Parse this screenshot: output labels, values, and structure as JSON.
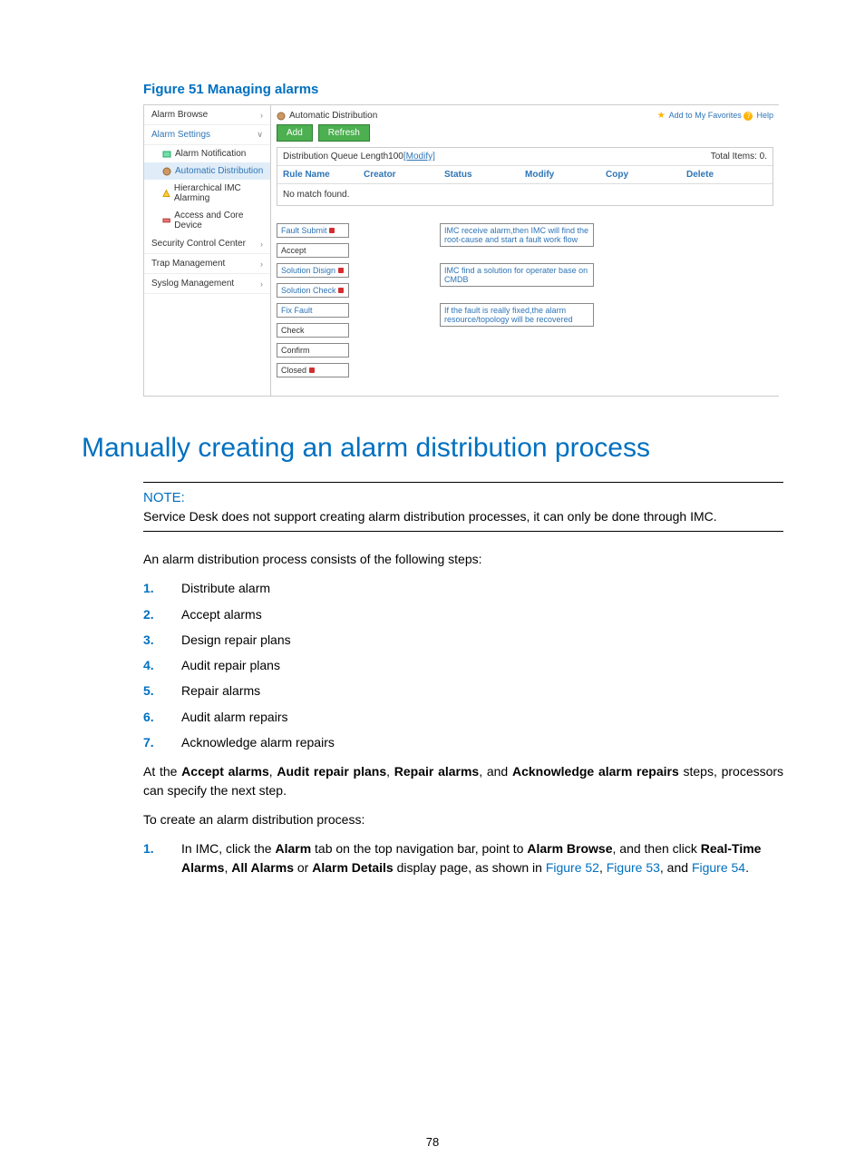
{
  "figure_caption": "Figure 51 Managing alarms",
  "screenshot": {
    "sidebar": {
      "alarm_browse": "Alarm Browse",
      "alarm_settings": "Alarm Settings",
      "alarm_notification": "Alarm Notification",
      "automatic_distribution": "Automatic Distribution",
      "hierarchical_imc": "Hierarchical IMC Alarming",
      "access_core": "Access and Core Device",
      "security_control": "Security Control Center",
      "trap_mgmt": "Trap Management",
      "syslog_mgmt": "Syslog Management"
    },
    "crumb_title": "Automatic Distribution",
    "add_favorites": "Add to My Favorites",
    "help_label": "Help",
    "add_btn": "Add",
    "refresh_btn": "Refresh",
    "queue_label": "Distribution Queue Length100",
    "queue_modify": "[Modify]",
    "total_items": "Total Items: 0.",
    "cols": {
      "rule_name": "Rule Name",
      "creator": "Creator",
      "status": "Status",
      "modify": "Modify",
      "copy": "Copy",
      "delete": "Delete"
    },
    "no_match": "No match found.",
    "flow": {
      "fault_submit": "Fault Submit",
      "accept": "Accept",
      "solution_design": "Solution Disign",
      "solution_check": "Solution Check",
      "fix_fault": "Fix Fault",
      "check": "Check",
      "confirm": "Confirm",
      "closed": "Closed",
      "ann1": "IMC receive alarm,then IMC will find the root-cause and start a fault work flow",
      "ann2": "IMC find a solution for operater base on CMDB",
      "ann3": "If the fault is really fixed,the alarm resource/topology will be recovered"
    }
  },
  "h1": "Manually creating an alarm distribution process",
  "note_label": "NOTE:",
  "note_text": "Service Desk does not support creating alarm distribution processes, it can only be done through IMC.",
  "intro": "An alarm distribution process consists of the following steps:",
  "list": [
    "Distribute alarm",
    "Accept alarms",
    "Design repair plans",
    "Audit repair plans",
    "Repair alarms",
    "Audit alarm repairs",
    "Acknowledge alarm repairs"
  ],
  "para2_1": "At the ",
  "para2_b1": "Accept alarms",
  "para2_2": ", ",
  "para2_b2": "Audit repair plans",
  "para2_3": ", ",
  "para2_b3": "Repair alarms",
  "para2_4": ", and ",
  "para2_b4": "Acknowledge alarm repairs",
  "para2_5": " steps, processors can specify the next step.",
  "create_intro": "To create an alarm distribution process:",
  "step1_a": "In IMC, click the ",
  "step1_b1": "Alarm",
  "step1_b": " tab on the top navigation bar, point to ",
  "step1_b2": "Alarm Browse",
  "step1_c": ", and then click ",
  "step1_b3": "Real-Time Alarms",
  "step1_d": ", ",
  "step1_b4": "All Alarms",
  "step1_e": " or ",
  "step1_b5": "Alarm Details",
  "step1_f": " display page, as shown in ",
  "step1_l1": "Figure 52",
  "step1_g": ", ",
  "step1_l2": "Figure 53",
  "step1_h": ", and ",
  "step1_l3": "Figure 54",
  "step1_i": ".",
  "page_number": "78"
}
